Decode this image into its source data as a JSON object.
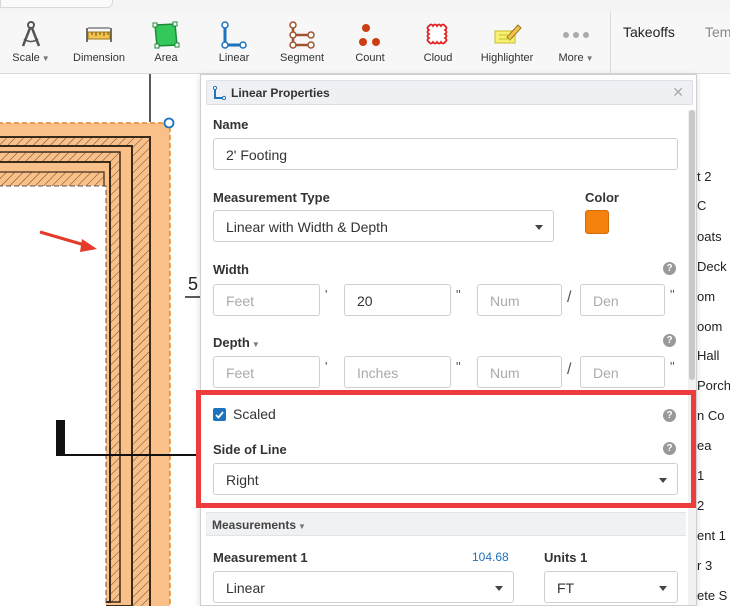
{
  "toolbar": {
    "tools": [
      {
        "label": "Scale",
        "icon": "compass-icon",
        "has_menu": true
      },
      {
        "label": "Dimension",
        "icon": "ruler-icon",
        "has_menu": false
      },
      {
        "label": "Area",
        "icon": "area-polygon-icon",
        "has_menu": false
      },
      {
        "label": "Linear",
        "icon": "linear-icon",
        "has_menu": false
      },
      {
        "label": "Segment",
        "icon": "segment-icon",
        "has_menu": false
      },
      {
        "label": "Count",
        "icon": "count-dots-icon",
        "has_menu": false
      },
      {
        "label": "Cloud",
        "icon": "cloud-icon",
        "has_menu": false
      },
      {
        "label": "Highlighter",
        "icon": "highlighter-icon",
        "has_menu": false
      },
      {
        "label": "More",
        "icon": "more-dots-icon",
        "has_menu": true
      }
    ]
  },
  "side_tabs": {
    "takeoffs": "Takeoffs",
    "templates": "Tem"
  },
  "right_list": [
    "t 2",
    "C",
    "oats",
    "Deck",
    "om",
    "oom",
    "Hall",
    "Porch",
    "n Co",
    "ea",
    "1",
    "2",
    "ent 1",
    "r 3",
    "ete S"
  ],
  "canvas": {
    "dimension_text": "5"
  },
  "panel": {
    "title": "Linear Properties",
    "name_label": "Name",
    "name_value": "2' Footing",
    "measurement_type_label": "Measurement Type",
    "measurement_type_value": "Linear with Width & Depth",
    "color_label": "Color",
    "color_value": "#f5820d",
    "width_label": "Width",
    "width": {
      "feet_placeholder": "Feet",
      "feet_unit": "'",
      "inches_value": "20",
      "inches_unit": "\"",
      "num_placeholder": "Num",
      "slash": "/",
      "den_placeholder": "Den",
      "den_unit": "\""
    },
    "depth_label": "Depth",
    "depth": {
      "feet_placeholder": "Feet",
      "feet_unit": "'",
      "inches_placeholder": "Inches",
      "inches_unit": "\"",
      "num_placeholder": "Num",
      "slash": "/",
      "den_placeholder": "Den",
      "den_unit": "\""
    },
    "scaled_label": "Scaled",
    "scaled_checked": true,
    "side_of_line_label": "Side of Line",
    "side_of_line_value": "Right",
    "measurements_section": "Measurements",
    "measurement1_label": "Measurement 1",
    "measurement1_value": "104.68",
    "measurement1_type": "Linear",
    "units1_label": "Units 1",
    "units1_value": "FT",
    "help_glyph": "?"
  },
  "colors": {
    "accent_blue": "#1e73be",
    "highlight_red": "#ee3b3b",
    "footing_orange": "#f9c08a"
  }
}
